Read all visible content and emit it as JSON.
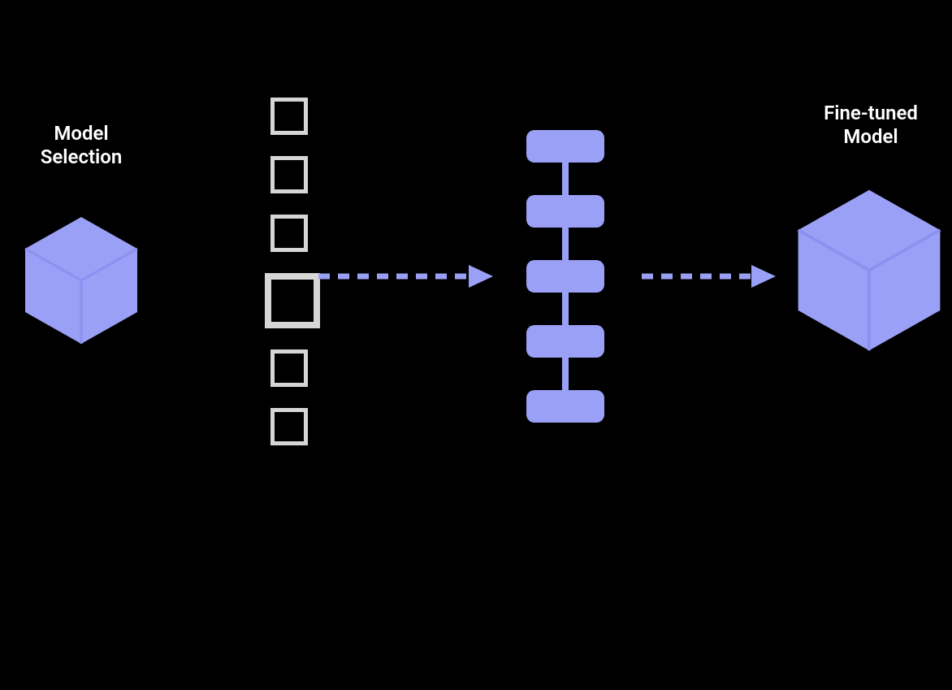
{
  "labels": {
    "left_line1": "Model",
    "left_line2": "Selection",
    "right_line1": "Fine-tuned",
    "right_line2": "Model"
  },
  "colors": {
    "accent": "#9aa0f6",
    "accent_dark": "#7f85e6",
    "square_border": "#d6d6d6",
    "text": "#ffffff",
    "background": "#000000"
  },
  "diagram": {
    "left_hexagon": "model-selection",
    "right_hexagon": "fine-tuned-model",
    "squares_count": 6,
    "square_highlight_index": 3,
    "purple_blocks_count": 5
  }
}
